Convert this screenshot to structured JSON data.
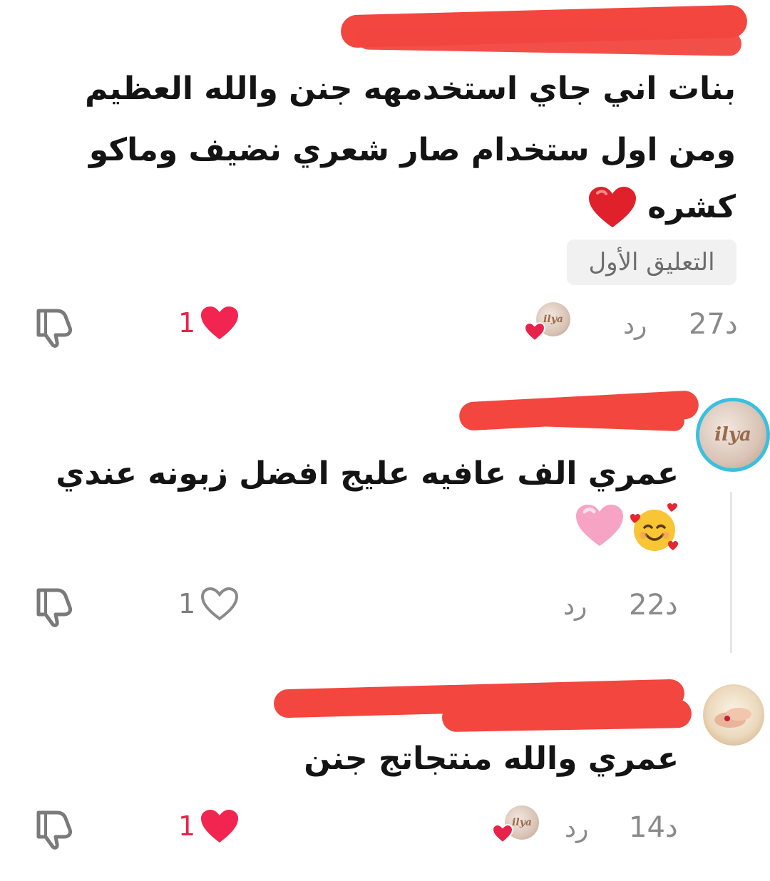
{
  "colors": {
    "redaction": "#f2463f",
    "like_red": "#e8234b",
    "meta_gray": "#8a8a8a",
    "avatar_ring": "#3bbfe0",
    "pill_bg": "#f1f1f1"
  },
  "comments": [
    {
      "username": "[redacted]",
      "lines": [
        "بنات اني جاي استخدمهه جنن والله العظيم",
        "ومن اول ستخدام صار شعري نضيف وماكو",
        "كشره"
      ],
      "emoji": "❤️",
      "badge": "التعليق الأول",
      "time": "27د",
      "reply_label": "رد",
      "likes": "1",
      "liked": true,
      "creator_liked_avatar_text": "ilya"
    },
    {
      "username": "[redacted]",
      "avatar_text": "ilya",
      "lines": [
        "عمري الف عافيه عليج افضل زبونه عندي"
      ],
      "emojis": [
        "🥰",
        "🩷"
      ],
      "time": "22د",
      "reply_label": "رد",
      "likes": "1",
      "liked": false
    },
    {
      "username": "[redacted]",
      "lines": [
        "عمري والله منتجاتج جنن"
      ],
      "time": "14د",
      "reply_label": "رد",
      "likes": "1",
      "liked": true,
      "creator_liked_avatar_text": "ilya"
    }
  ],
  "icons": {
    "dislike": "thumbs-down-icon",
    "like_filled": "heart-filled-icon",
    "like_outline": "heart-outline-icon"
  }
}
